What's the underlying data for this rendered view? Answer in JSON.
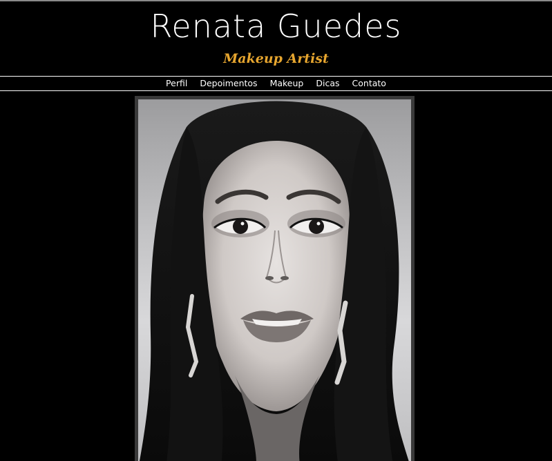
{
  "header": {
    "title": "Renata Guedes",
    "tagline": "Makeup Artist"
  },
  "nav": {
    "items": [
      {
        "label": "Perfil"
      },
      {
        "label": "Depoimentos"
      },
      {
        "label": "Makeup"
      },
      {
        "label": "Dicas"
      },
      {
        "label": "Contato"
      }
    ]
  },
  "main": {
    "photo": {
      "subject": "black-and-white portrait of a woman"
    }
  },
  "colors": {
    "background": "#000000",
    "title": "#ffffff",
    "tagline": "#e7a62f",
    "frame": "#3a3a3a"
  }
}
